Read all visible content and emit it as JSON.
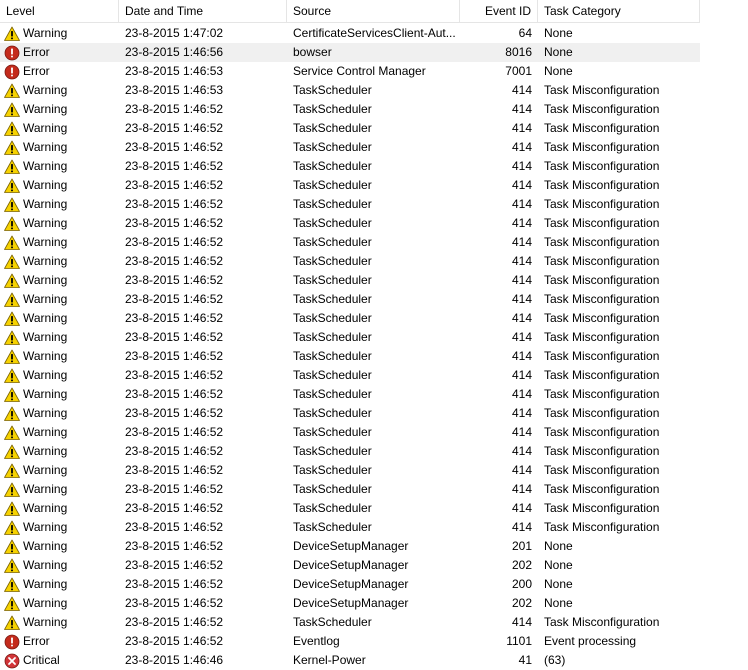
{
  "columns": {
    "level": "Level",
    "date_time": "Date and Time",
    "source": "Source",
    "event_id": "Event ID",
    "task_category": "Task Category"
  },
  "colors": {
    "warning_fill": "#f6d200",
    "error_fill": "#c42b1c",
    "critical_fill": "#d13438",
    "selected_row": "#f0f0f0"
  },
  "rows": [
    {
      "level": "Warning",
      "icon": "warning-icon",
      "date": "23-8-2015 1:47:02",
      "source": "CertificateServicesClient-Aut...",
      "event_id": "64",
      "task": "None"
    },
    {
      "level": "Error",
      "icon": "error-icon",
      "date": "23-8-2015 1:46:56",
      "source": "bowser",
      "event_id": "8016",
      "task": "None",
      "selected": true
    },
    {
      "level": "Error",
      "icon": "error-icon",
      "date": "23-8-2015 1:46:53",
      "source": "Service Control Manager",
      "event_id": "7001",
      "task": "None"
    },
    {
      "level": "Warning",
      "icon": "warning-icon",
      "date": "23-8-2015 1:46:53",
      "source": "TaskScheduler",
      "event_id": "414",
      "task": "Task Misconfiguration"
    },
    {
      "level": "Warning",
      "icon": "warning-icon",
      "date": "23-8-2015 1:46:52",
      "source": "TaskScheduler",
      "event_id": "414",
      "task": "Task Misconfiguration"
    },
    {
      "level": "Warning",
      "icon": "warning-icon",
      "date": "23-8-2015 1:46:52",
      "source": "TaskScheduler",
      "event_id": "414",
      "task": "Task Misconfiguration"
    },
    {
      "level": "Warning",
      "icon": "warning-icon",
      "date": "23-8-2015 1:46:52",
      "source": "TaskScheduler",
      "event_id": "414",
      "task": "Task Misconfiguration"
    },
    {
      "level": "Warning",
      "icon": "warning-icon",
      "date": "23-8-2015 1:46:52",
      "source": "TaskScheduler",
      "event_id": "414",
      "task": "Task Misconfiguration"
    },
    {
      "level": "Warning",
      "icon": "warning-icon",
      "date": "23-8-2015 1:46:52",
      "source": "TaskScheduler",
      "event_id": "414",
      "task": "Task Misconfiguration"
    },
    {
      "level": "Warning",
      "icon": "warning-icon",
      "date": "23-8-2015 1:46:52",
      "source": "TaskScheduler",
      "event_id": "414",
      "task": "Task Misconfiguration"
    },
    {
      "level": "Warning",
      "icon": "warning-icon",
      "date": "23-8-2015 1:46:52",
      "source": "TaskScheduler",
      "event_id": "414",
      "task": "Task Misconfiguration"
    },
    {
      "level": "Warning",
      "icon": "warning-icon",
      "date": "23-8-2015 1:46:52",
      "source": "TaskScheduler",
      "event_id": "414",
      "task": "Task Misconfiguration"
    },
    {
      "level": "Warning",
      "icon": "warning-icon",
      "date": "23-8-2015 1:46:52",
      "source": "TaskScheduler",
      "event_id": "414",
      "task": "Task Misconfiguration"
    },
    {
      "level": "Warning",
      "icon": "warning-icon",
      "date": "23-8-2015 1:46:52",
      "source": "TaskScheduler",
      "event_id": "414",
      "task": "Task Misconfiguration"
    },
    {
      "level": "Warning",
      "icon": "warning-icon",
      "date": "23-8-2015 1:46:52",
      "source": "TaskScheduler",
      "event_id": "414",
      "task": "Task Misconfiguration"
    },
    {
      "level": "Warning",
      "icon": "warning-icon",
      "date": "23-8-2015 1:46:52",
      "source": "TaskScheduler",
      "event_id": "414",
      "task": "Task Misconfiguration"
    },
    {
      "level": "Warning",
      "icon": "warning-icon",
      "date": "23-8-2015 1:46:52",
      "source": "TaskScheduler",
      "event_id": "414",
      "task": "Task Misconfiguration"
    },
    {
      "level": "Warning",
      "icon": "warning-icon",
      "date": "23-8-2015 1:46:52",
      "source": "TaskScheduler",
      "event_id": "414",
      "task": "Task Misconfiguration"
    },
    {
      "level": "Warning",
      "icon": "warning-icon",
      "date": "23-8-2015 1:46:52",
      "source": "TaskScheduler",
      "event_id": "414",
      "task": "Task Misconfiguration"
    },
    {
      "level": "Warning",
      "icon": "warning-icon",
      "date": "23-8-2015 1:46:52",
      "source": "TaskScheduler",
      "event_id": "414",
      "task": "Task Misconfiguration"
    },
    {
      "level": "Warning",
      "icon": "warning-icon",
      "date": "23-8-2015 1:46:52",
      "source": "TaskScheduler",
      "event_id": "414",
      "task": "Task Misconfiguration"
    },
    {
      "level": "Warning",
      "icon": "warning-icon",
      "date": "23-8-2015 1:46:52",
      "source": "TaskScheduler",
      "event_id": "414",
      "task": "Task Misconfiguration"
    },
    {
      "level": "Warning",
      "icon": "warning-icon",
      "date": "23-8-2015 1:46:52",
      "source": "TaskScheduler",
      "event_id": "414",
      "task": "Task Misconfiguration"
    },
    {
      "level": "Warning",
      "icon": "warning-icon",
      "date": "23-8-2015 1:46:52",
      "source": "TaskScheduler",
      "event_id": "414",
      "task": "Task Misconfiguration"
    },
    {
      "level": "Warning",
      "icon": "warning-icon",
      "date": "23-8-2015 1:46:52",
      "source": "TaskScheduler",
      "event_id": "414",
      "task": "Task Misconfiguration"
    },
    {
      "level": "Warning",
      "icon": "warning-icon",
      "date": "23-8-2015 1:46:52",
      "source": "TaskScheduler",
      "event_id": "414",
      "task": "Task Misconfiguration"
    },
    {
      "level": "Warning",
      "icon": "warning-icon",
      "date": "23-8-2015 1:46:52",
      "source": "TaskScheduler",
      "event_id": "414",
      "task": "Task Misconfiguration"
    },
    {
      "level": "Warning",
      "icon": "warning-icon",
      "date": "23-8-2015 1:46:52",
      "source": "DeviceSetupManager",
      "event_id": "201",
      "task": "None"
    },
    {
      "level": "Warning",
      "icon": "warning-icon",
      "date": "23-8-2015 1:46:52",
      "source": "DeviceSetupManager",
      "event_id": "202",
      "task": "None"
    },
    {
      "level": "Warning",
      "icon": "warning-icon",
      "date": "23-8-2015 1:46:52",
      "source": "DeviceSetupManager",
      "event_id": "200",
      "task": "None"
    },
    {
      "level": "Warning",
      "icon": "warning-icon",
      "date": "23-8-2015 1:46:52",
      "source": "DeviceSetupManager",
      "event_id": "202",
      "task": "None"
    },
    {
      "level": "Warning",
      "icon": "warning-icon",
      "date": "23-8-2015 1:46:52",
      "source": "TaskScheduler",
      "event_id": "414",
      "task": "Task Misconfiguration"
    },
    {
      "level": "Error",
      "icon": "error-icon",
      "date": "23-8-2015 1:46:52",
      "source": "Eventlog",
      "event_id": "1101",
      "task": "Event processing"
    },
    {
      "level": "Critical",
      "icon": "critical-icon",
      "date": "23-8-2015 1:46:46",
      "source": "Kernel-Power",
      "event_id": "41",
      "task": "(63)"
    }
  ]
}
